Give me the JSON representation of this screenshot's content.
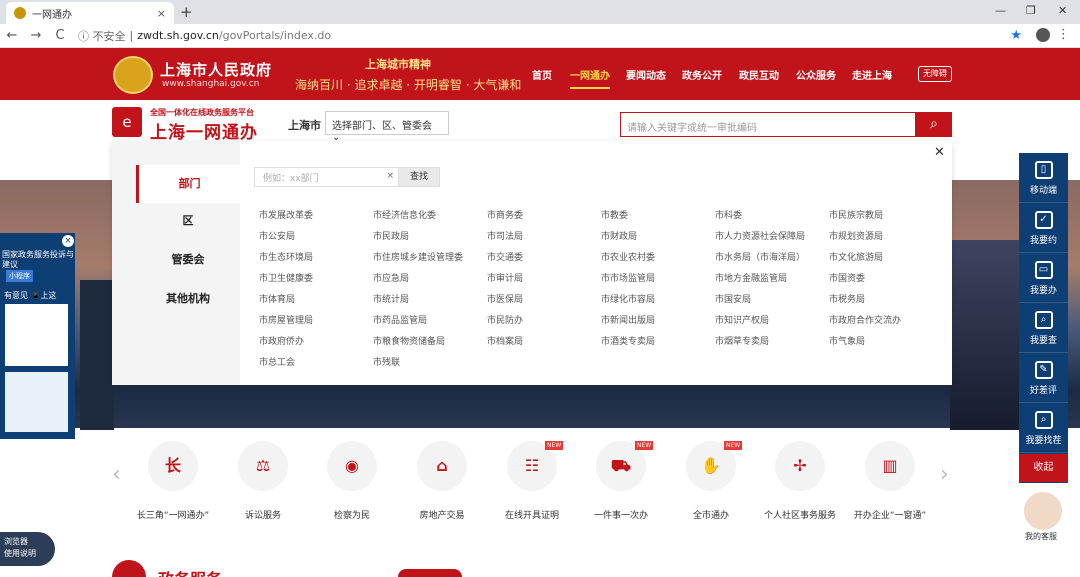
{
  "browser": {
    "tab_title": "一网通办",
    "tab_close": "×",
    "new_tab": "+",
    "win_min": "—",
    "win_max": "❐",
    "win_close": "✕",
    "back": "←",
    "forward": "→",
    "reload": "C",
    "security": "ⓘ 不安全",
    "separator": "|",
    "url_host": "zwdt.sh.gov.cn",
    "url_path": "/govPortals/index.do",
    "star": "★",
    "menu": "⋮"
  },
  "header": {
    "gov_name": "上海市人民政府",
    "gov_url": "www.shanghai.gov.cn",
    "spirit_title": "上海城市精神",
    "spirit_text": "海纳百川 · 追求卓越 · 开明睿智 · 大气谦和",
    "nav": [
      "首页",
      "一网通办",
      "要闻动态",
      "政务公开",
      "政民互动",
      "公众服务",
      "走进上海"
    ],
    "accessibility": "无障碍"
  },
  "subheader": {
    "platform": "全国一体化在线政务服务平台",
    "name": "上海一网通办",
    "city": "上海市",
    "dept_select": "选择部门、区、管委会",
    "dept_chevron": "⌄",
    "search_placeholder": "请输入关键字或统一审批编码",
    "search_icon": "⌕"
  },
  "panel": {
    "close": "✕",
    "side": [
      "部门",
      "区",
      "管委会",
      "其他机构"
    ],
    "search_placeholder": "例如：xx部门",
    "clear": "×",
    "search_button": "查找",
    "agencies": [
      [
        "市发展改革委",
        "市经济信息化委",
        "市商务委",
        "市教委",
        "市科委",
        "市民族宗教局"
      ],
      [
        "市公安局",
        "市民政局",
        "市司法局",
        "市财政局",
        "市人力资源社会保障局",
        "市规划资源局"
      ],
      [
        "市生态环境局",
        "市住房城乡建设管理委",
        "市交通委",
        "市农业农村委",
        "市水务局（市海洋局）",
        "市文化旅游局"
      ],
      [
        "市卫生健康委",
        "市应急局",
        "市审计局",
        "市市场监管局",
        "市地方金融监管局",
        "市国资委"
      ],
      [
        "市体育局",
        "市统计局",
        "市医保局",
        "市绿化市容局",
        "市国安局",
        "市税务局"
      ],
      [
        "市房屋管理局",
        "市药品监管局",
        "市民防办",
        "市新闻出版局",
        "市知识产权局",
        "市政府合作交流办"
      ],
      [
        "市政府侨办",
        "市粮食物资储备局",
        "市档案局",
        "市酒类专卖局",
        "市烟草专卖局",
        "市气象局"
      ],
      [
        "市总工会",
        "市残联"
      ]
    ]
  },
  "right_float": {
    "items": [
      "移动端",
      "我要约",
      "我要办",
      "我要查",
      "好差评",
      "我要找茬"
    ],
    "icons": [
      "▯",
      "✓",
      "▭",
      "⌕",
      "✎",
      "⌕"
    ],
    "collapse": "收起",
    "cs_label": "我的客服"
  },
  "left_float": {
    "close": "×",
    "title": "国家政务服务投诉与建议",
    "mini": "小程序",
    "hint": "有意见 📱上这"
  },
  "services": {
    "prev": "‹",
    "next": "›",
    "items": [
      {
        "label": "长三角“一网通办”",
        "icon": "长"
      },
      {
        "label": "诉讼服务",
        "icon": "⚖"
      },
      {
        "label": "检察为民",
        "icon": "◉"
      },
      {
        "label": "房地产交易",
        "icon": "⌂"
      },
      {
        "label": "在线开具证明",
        "icon": "☷"
      },
      {
        "label": "一件事一次办",
        "icon": "⛟"
      },
      {
        "label": "全市通办",
        "icon": "✋"
      },
      {
        "label": "个人社区事务服务",
        "icon": "✢"
      },
      {
        "label": "开办企业“一窗通”",
        "icon": "▥"
      }
    ],
    "new_badge": "NEW"
  },
  "bottom": {
    "guide_line1": "浏览器",
    "guide_line2": "使用说明",
    "section_title": "政务服务"
  }
}
